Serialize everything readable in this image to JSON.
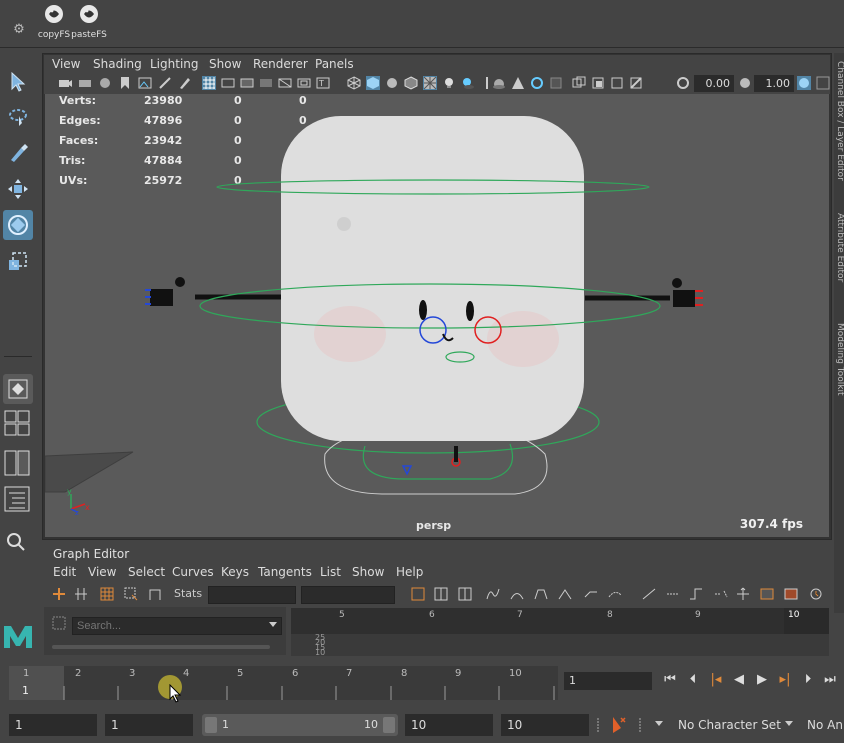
{
  "shelf": {
    "buttons": [
      {
        "label": "copyFS",
        "icon": "python-icon"
      },
      {
        "label": "pasteFS",
        "icon": "python-icon"
      }
    ]
  },
  "viewport": {
    "menus": [
      "View",
      "Shading",
      "Lighting",
      "Show",
      "Renderer",
      "Panels"
    ],
    "toolbar": {
      "exposure": "0.00",
      "gamma": "1.00"
    },
    "hud": {
      "rows": [
        {
          "label": "Verts:",
          "v1": "23980",
          "v2": "0",
          "v3": "0"
        },
        {
          "label": "Edges:",
          "v1": "47896",
          "v2": "0",
          "v3": "0"
        },
        {
          "label": "Faces:",
          "v1": "23942",
          "v2": "0",
          "v3": "0"
        },
        {
          "label": "Tris:",
          "v1": "47884",
          "v2": "0",
          "v3": "0"
        },
        {
          "label": "UVs:",
          "v1": "25972",
          "v2": "0",
          "v3": "0"
        }
      ]
    },
    "camera": "persp",
    "fps": "307.4 fps",
    "axis": {
      "y": "y",
      "x": "x",
      "z": "z"
    }
  },
  "right_tabs": [
    "Channel Box / Layer Editor",
    "Attribute Editor",
    "Modeling Toolkit"
  ],
  "graph_editor": {
    "title": "Graph Editor",
    "menus": [
      "Edit",
      "View",
      "Select",
      "Curves",
      "Keys",
      "Tangents",
      "List",
      "Show",
      "Help"
    ],
    "stats_label": "Stats",
    "search_placeholder": "Search...",
    "ruler": [
      "5",
      "6",
      "7",
      "8",
      "9",
      "10"
    ],
    "side_values": [
      "25",
      "20",
      "15",
      "10"
    ]
  },
  "timeslider": {
    "ticks": [
      "1",
      "2",
      "3",
      "4",
      "5",
      "6",
      "7",
      "8",
      "9",
      "10"
    ],
    "current": "1",
    "current_frame": "1"
  },
  "range": {
    "start_time": "1",
    "playback_start": "1",
    "slider_start": "1",
    "slider_end": "10",
    "playback_end": "10",
    "end_time": "10",
    "character_set": "No Character Set",
    "anim_layer": "No Anim"
  },
  "colors": {
    "accent": "#5285a6",
    "viewport_bg": "#5a5a5a",
    "current_frame_marker": "#b5a832"
  }
}
